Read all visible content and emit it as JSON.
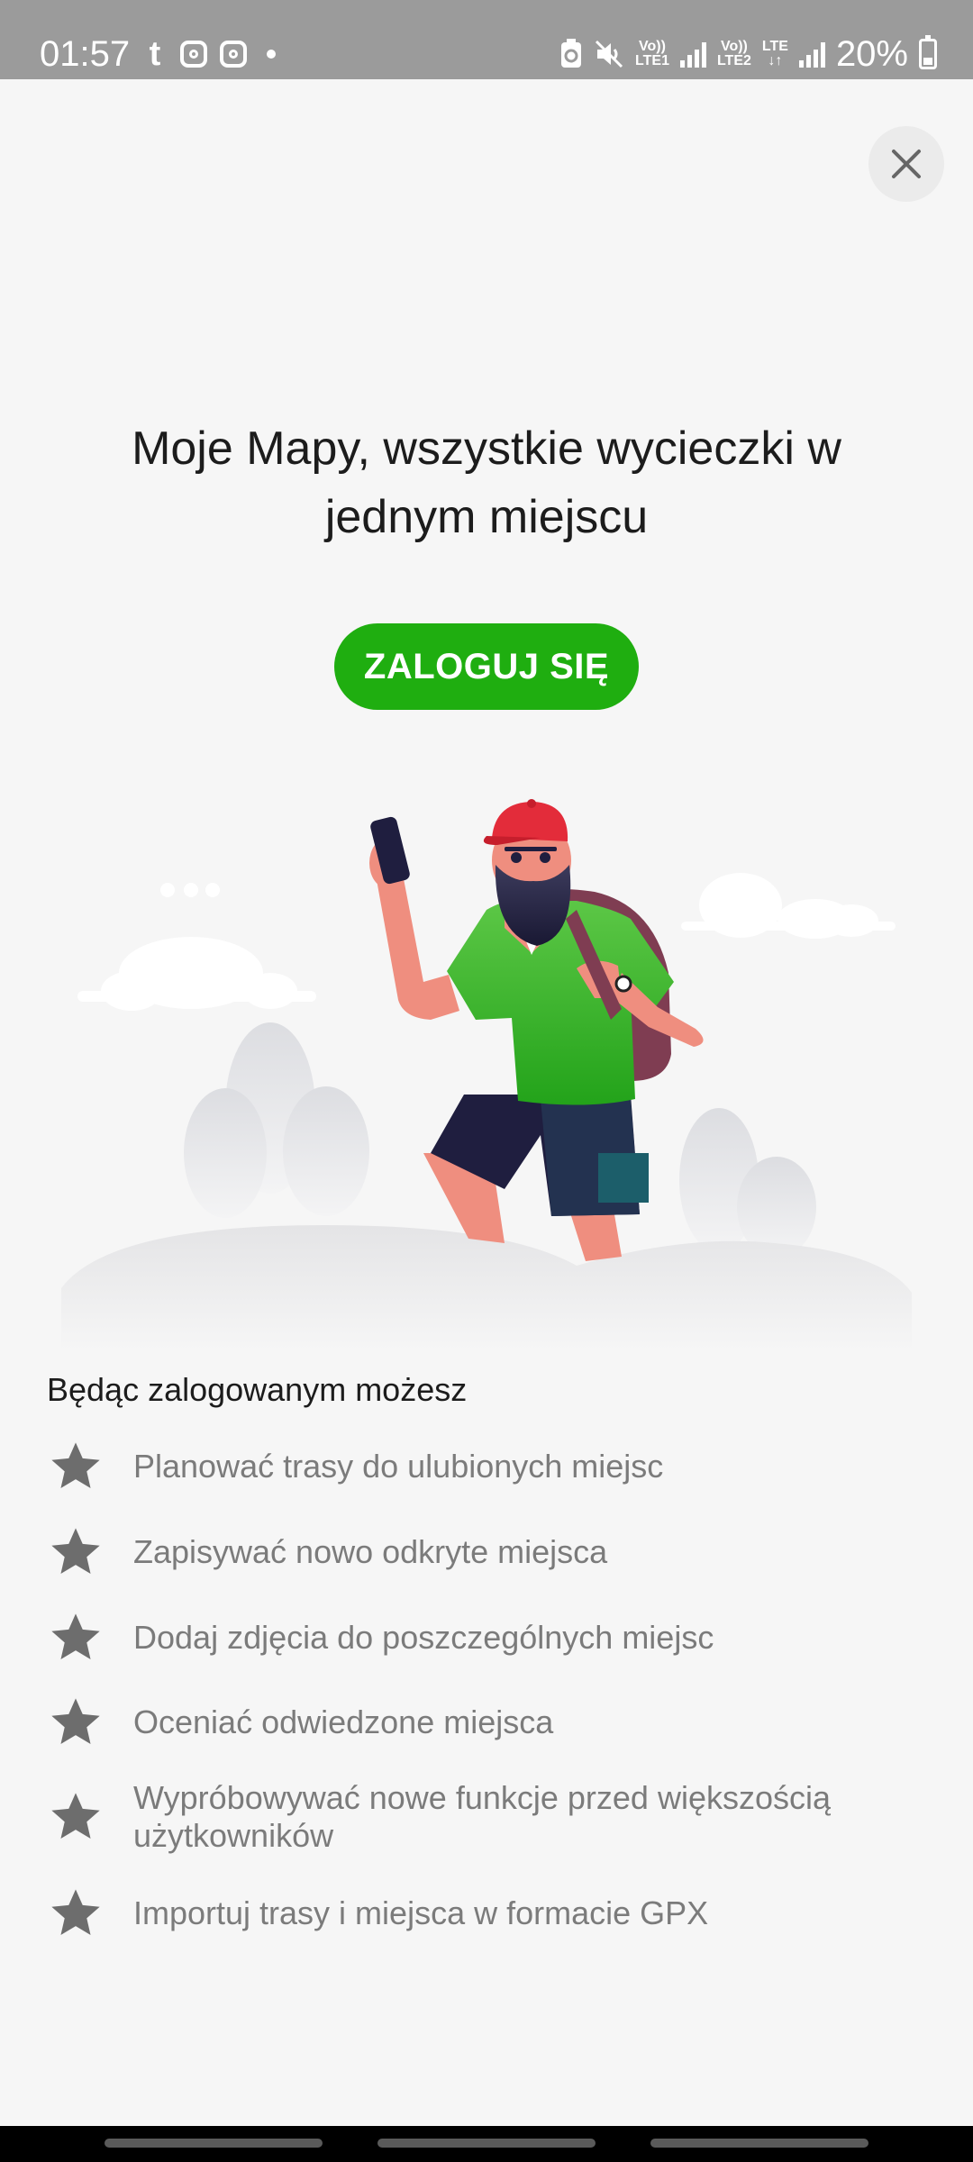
{
  "status_bar": {
    "time": "01:57",
    "battery": "20%",
    "sim1_label_top": "Vo))",
    "sim1_label_bottom": "LTE1",
    "sim2_label_top": "Vo))",
    "sim2_label_bottom": "LTE2",
    "lte_label": "LTE",
    "icons": [
      "tumblr-icon",
      "instagram-icon",
      "instagram-icon",
      "dot-icon",
      "recycle-icon",
      "mute-icon",
      "signal-icon",
      "battery-icon"
    ]
  },
  "close": {
    "icon": "close-icon"
  },
  "headline": "Moje Mapy, wszystkie wycieczki w jednym miejscu",
  "login_button": "ZALOGUJ SIĘ",
  "benefits": {
    "title": "Będąc zalogowanym możesz",
    "items": [
      "Planować trasy do ulubionych miejsc",
      "Zapisywać nowo odkryte miejsca",
      "Dodaj zdjęcia do poszczególnych miejsc",
      "Oceniać odwiedzone miejsca",
      "Wypróbowywać nowe funkcje przed większością użytkowników",
      "Importuj trasy i miejsca w formacie GPX"
    ]
  },
  "colors": {
    "accent": "#1fae10",
    "background": "#f6f6f6",
    "status_bar": "#9b9b9b"
  }
}
